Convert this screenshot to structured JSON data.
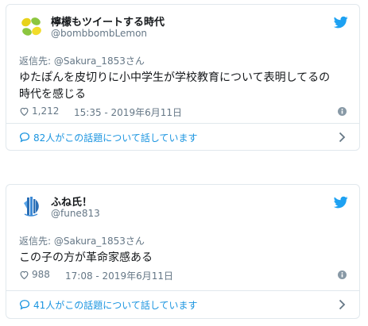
{
  "tweets": [
    {
      "display_name": "檸檬もツイートする時代",
      "handle": "@bombbombLemon",
      "reply_label": "返信先: ",
      "reply_mention": "@Sakura_1853さん",
      "text_lines": [
        "ゆたぽんを皮切りに小中学生が学校教育について表明してるの",
        "時代を感じる"
      ],
      "likes": "1,212",
      "timestamp": "15:35 - 2019年6月11日",
      "conversation": "82人がこの話題について話しています",
      "avatar_icon": "lemon-logo-icon",
      "colors": {
        "link": "#1b95e0",
        "muted": "#657786",
        "twitter_blue": "#1da1f2"
      }
    },
    {
      "display_name": "ふね氏！",
      "handle": "@fune813",
      "reply_label": "返信先: ",
      "reply_mention": "@Sakura_1853さん",
      "text_lines": [
        "この子の方が革命家感ある"
      ],
      "likes": "988",
      "timestamp": "17:08 - 2019年6月11日",
      "conversation": "41人がこの話題について話しています",
      "avatar_icon": "blue-ship-logo-icon"
    }
  ]
}
